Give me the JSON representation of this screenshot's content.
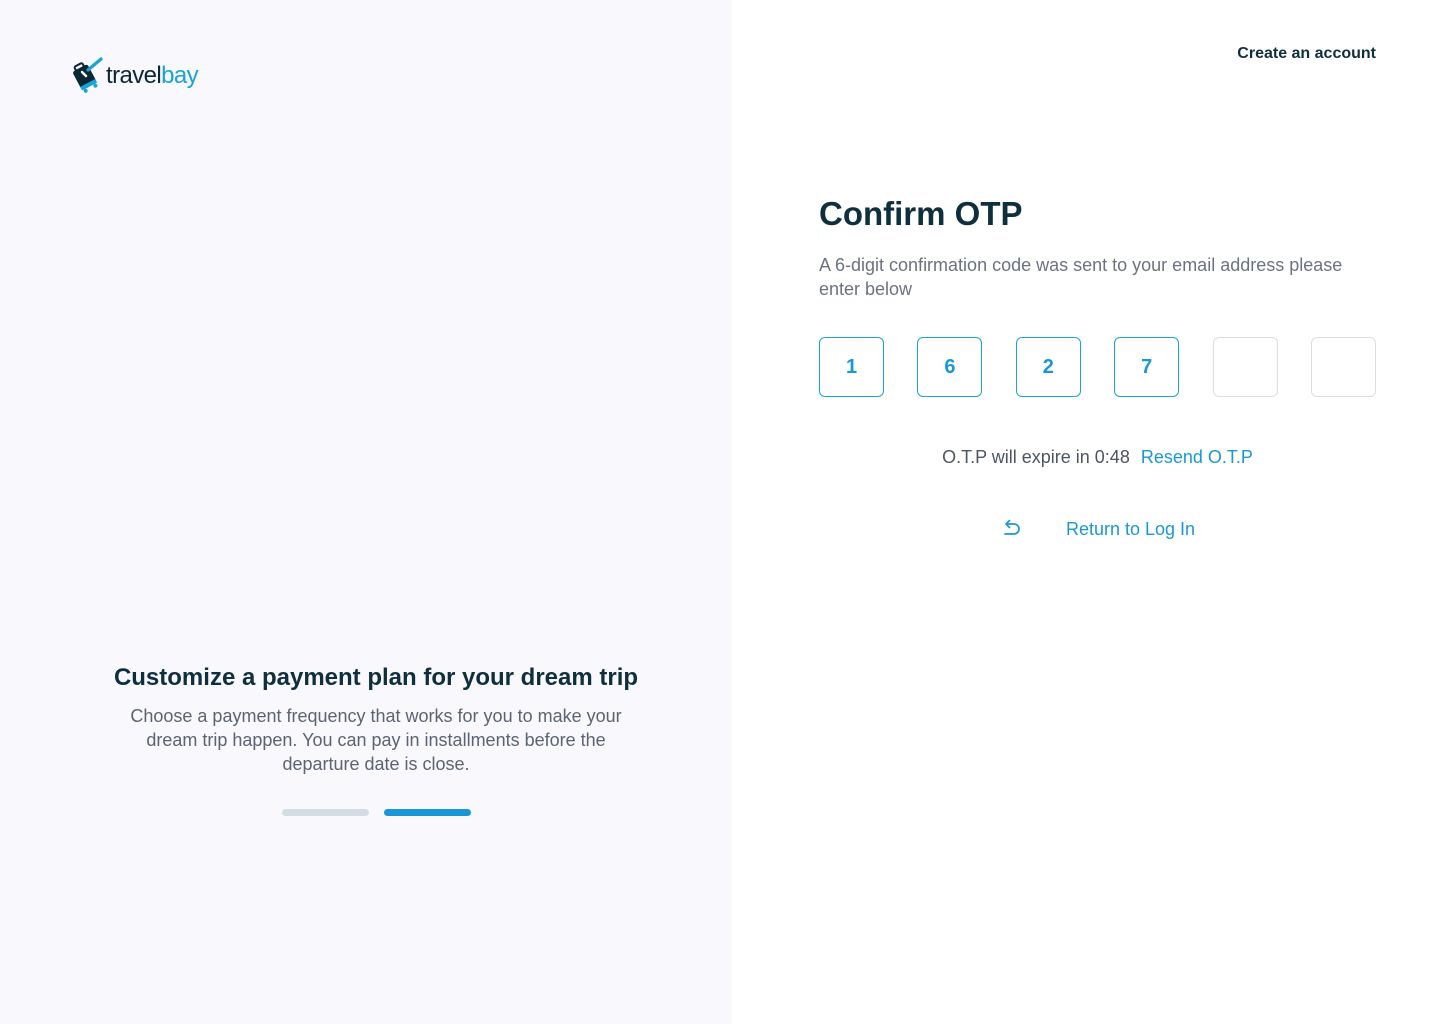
{
  "brand": {
    "name_part1": "travel",
    "name_part2": "bay",
    "logo_icon": "suitcase-check-icon"
  },
  "header": {
    "create_account_label": "Create an account"
  },
  "promo": {
    "title": "Customize a payment plan for your dream trip",
    "body": "Choose a payment frequency that works for you to make your dream trip happen. You can pay in installments before the departure date is close.",
    "carousel": {
      "slide_count": 2,
      "active_index": 1
    }
  },
  "otp_form": {
    "title": "Confirm OTP",
    "description": "A 6-digit confirmation code was sent to your email address please enter below",
    "digits": [
      "1",
      "6",
      "2",
      "7",
      "",
      ""
    ],
    "timer_text": "O.T.P will expire in 0:48",
    "resend_label": "Resend O.T.P",
    "return_label": "Return to Log In",
    "return_icon": "undo-arrow-icon"
  },
  "colors": {
    "accent": "#1a98d5",
    "heading": "#0f2f3e",
    "muted_text": "#6b7280",
    "left_panel_bg": "#f8f8fd",
    "empty_box_border": "#dcdee3",
    "inactive_dot": "#d3dde3"
  }
}
